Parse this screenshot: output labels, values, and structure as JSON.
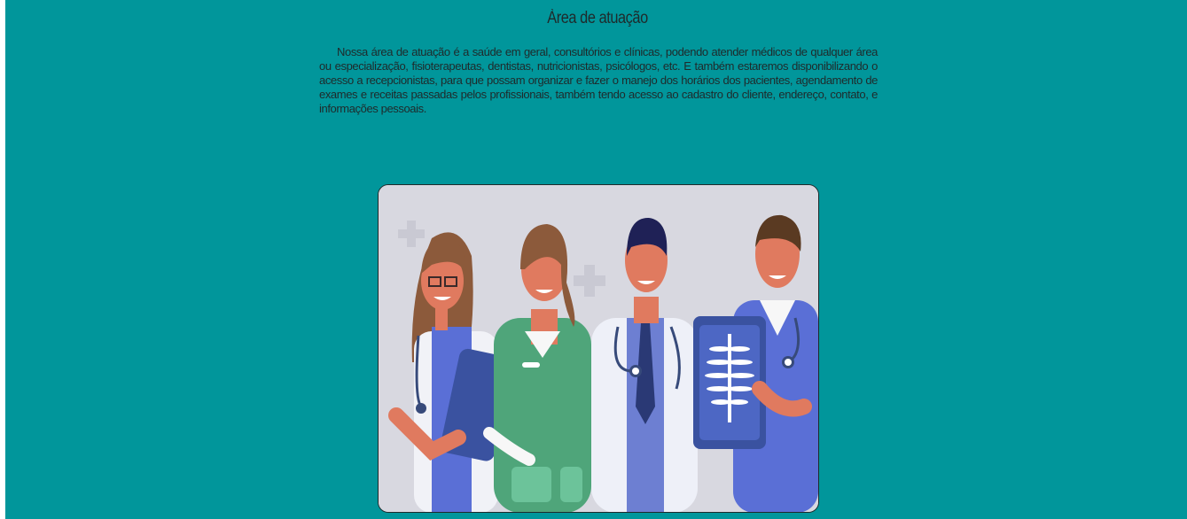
{
  "section": {
    "title": "Àrea de atuação",
    "description": "Nossa área de atuação é a saúde em geral, consultórios e clínicas, podendo atender médicos de qualquer área ou especialização, fisioterapeutas, dentistas, nutricionistas, psicólogos, etc. E também estaremos disponibilizando o acesso a recepcionistas, para que possam organizar e fazer o manejo dos horários dos pacientes, agendamento de exames e receitas passadas pelos profissionais, também tendo acesso ao cadastro do cliente, endereço, contato, e informações pessoais."
  },
  "illustration": {
    "name": "health-professionals-illustration"
  },
  "colors": {
    "page_background": "#01969b",
    "text": "#1f2a2b",
    "illustration_background": "#d8d8e0"
  }
}
